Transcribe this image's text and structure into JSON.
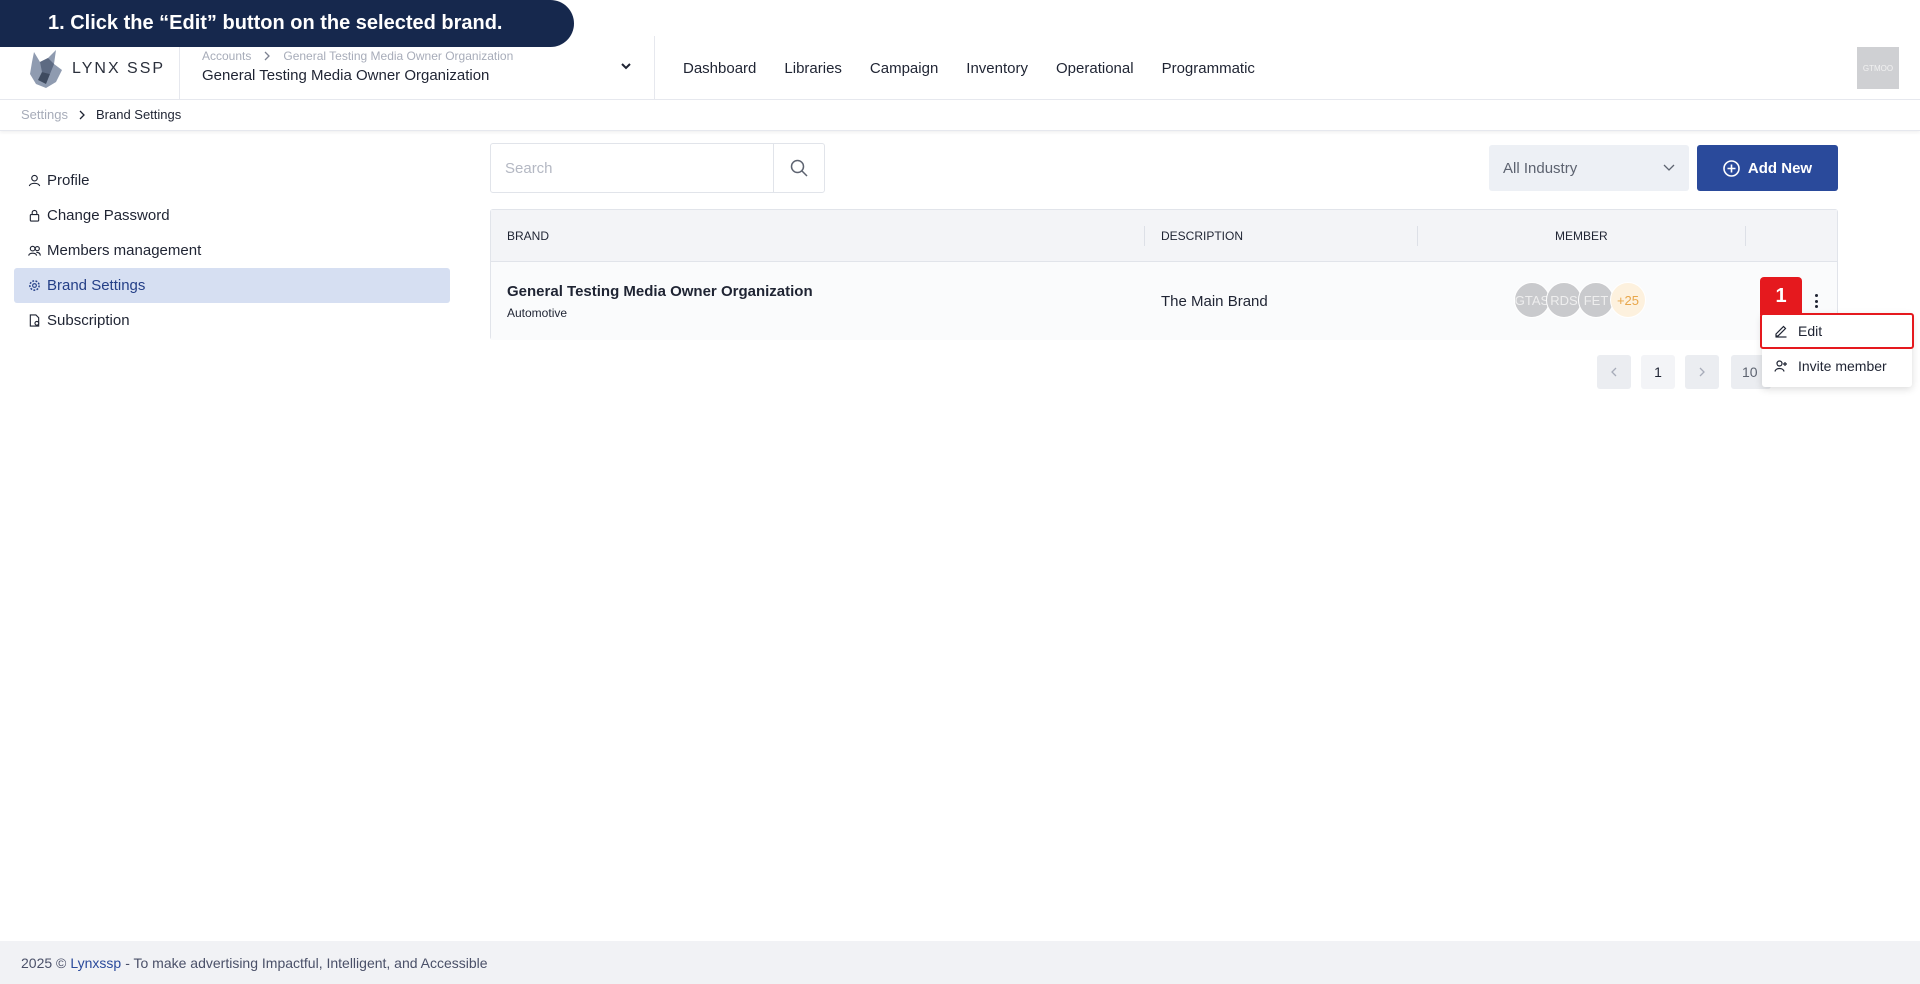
{
  "instruction": "1. Click the “Edit” button on the selected brand.",
  "header": {
    "logo_text": "LYNX SSP",
    "org_crumb_root": "Accounts",
    "org_crumb_current": "General Testing Media Owner Organization",
    "org_name": "General Testing Media Owner Organization",
    "nav": [
      "Dashboard",
      "Libraries",
      "Campaign",
      "Inventory",
      "Operational",
      "Programmatic"
    ],
    "avatar_text": "GTMOO"
  },
  "breadcrumb": {
    "root": "Settings",
    "current": "Brand Settings"
  },
  "sidebar": {
    "items": [
      {
        "label": "Profile",
        "icon": "user-icon"
      },
      {
        "label": "Change Password",
        "icon": "lock-icon"
      },
      {
        "label": "Members management",
        "icon": "users-icon"
      },
      {
        "label": "Brand Settings",
        "icon": "gear-icon",
        "active": true
      },
      {
        "label": "Subscription",
        "icon": "document-icon"
      }
    ]
  },
  "toolbar": {
    "search_placeholder": "Search",
    "industry_filter": "All Industry",
    "add_button": "Add New"
  },
  "table": {
    "columns": [
      "BRAND",
      "DESCRIPTION",
      "MEMBER"
    ],
    "rows": [
      {
        "brand": "General Testing Media Owner Organization",
        "industry": "Automotive",
        "description": "The Main Brand",
        "members": [
          "GTAS",
          "RDS",
          "FET"
        ],
        "more_members": "+25"
      }
    ]
  },
  "row_menu": {
    "edit": "Edit",
    "invite": "Invite member"
  },
  "step_badge": "1",
  "pagination": {
    "current_page": "1",
    "page_size": "10"
  },
  "footer": {
    "prefix": "2025 ©",
    "link": "Lynxssp",
    "suffix": "- To make advertising Impactful, Intelligent, and Accessible"
  },
  "colors": {
    "primary": "#2a4a9b",
    "banner": "#16284d",
    "highlight": "#e5191e",
    "active_bg": "#d6dff2"
  }
}
